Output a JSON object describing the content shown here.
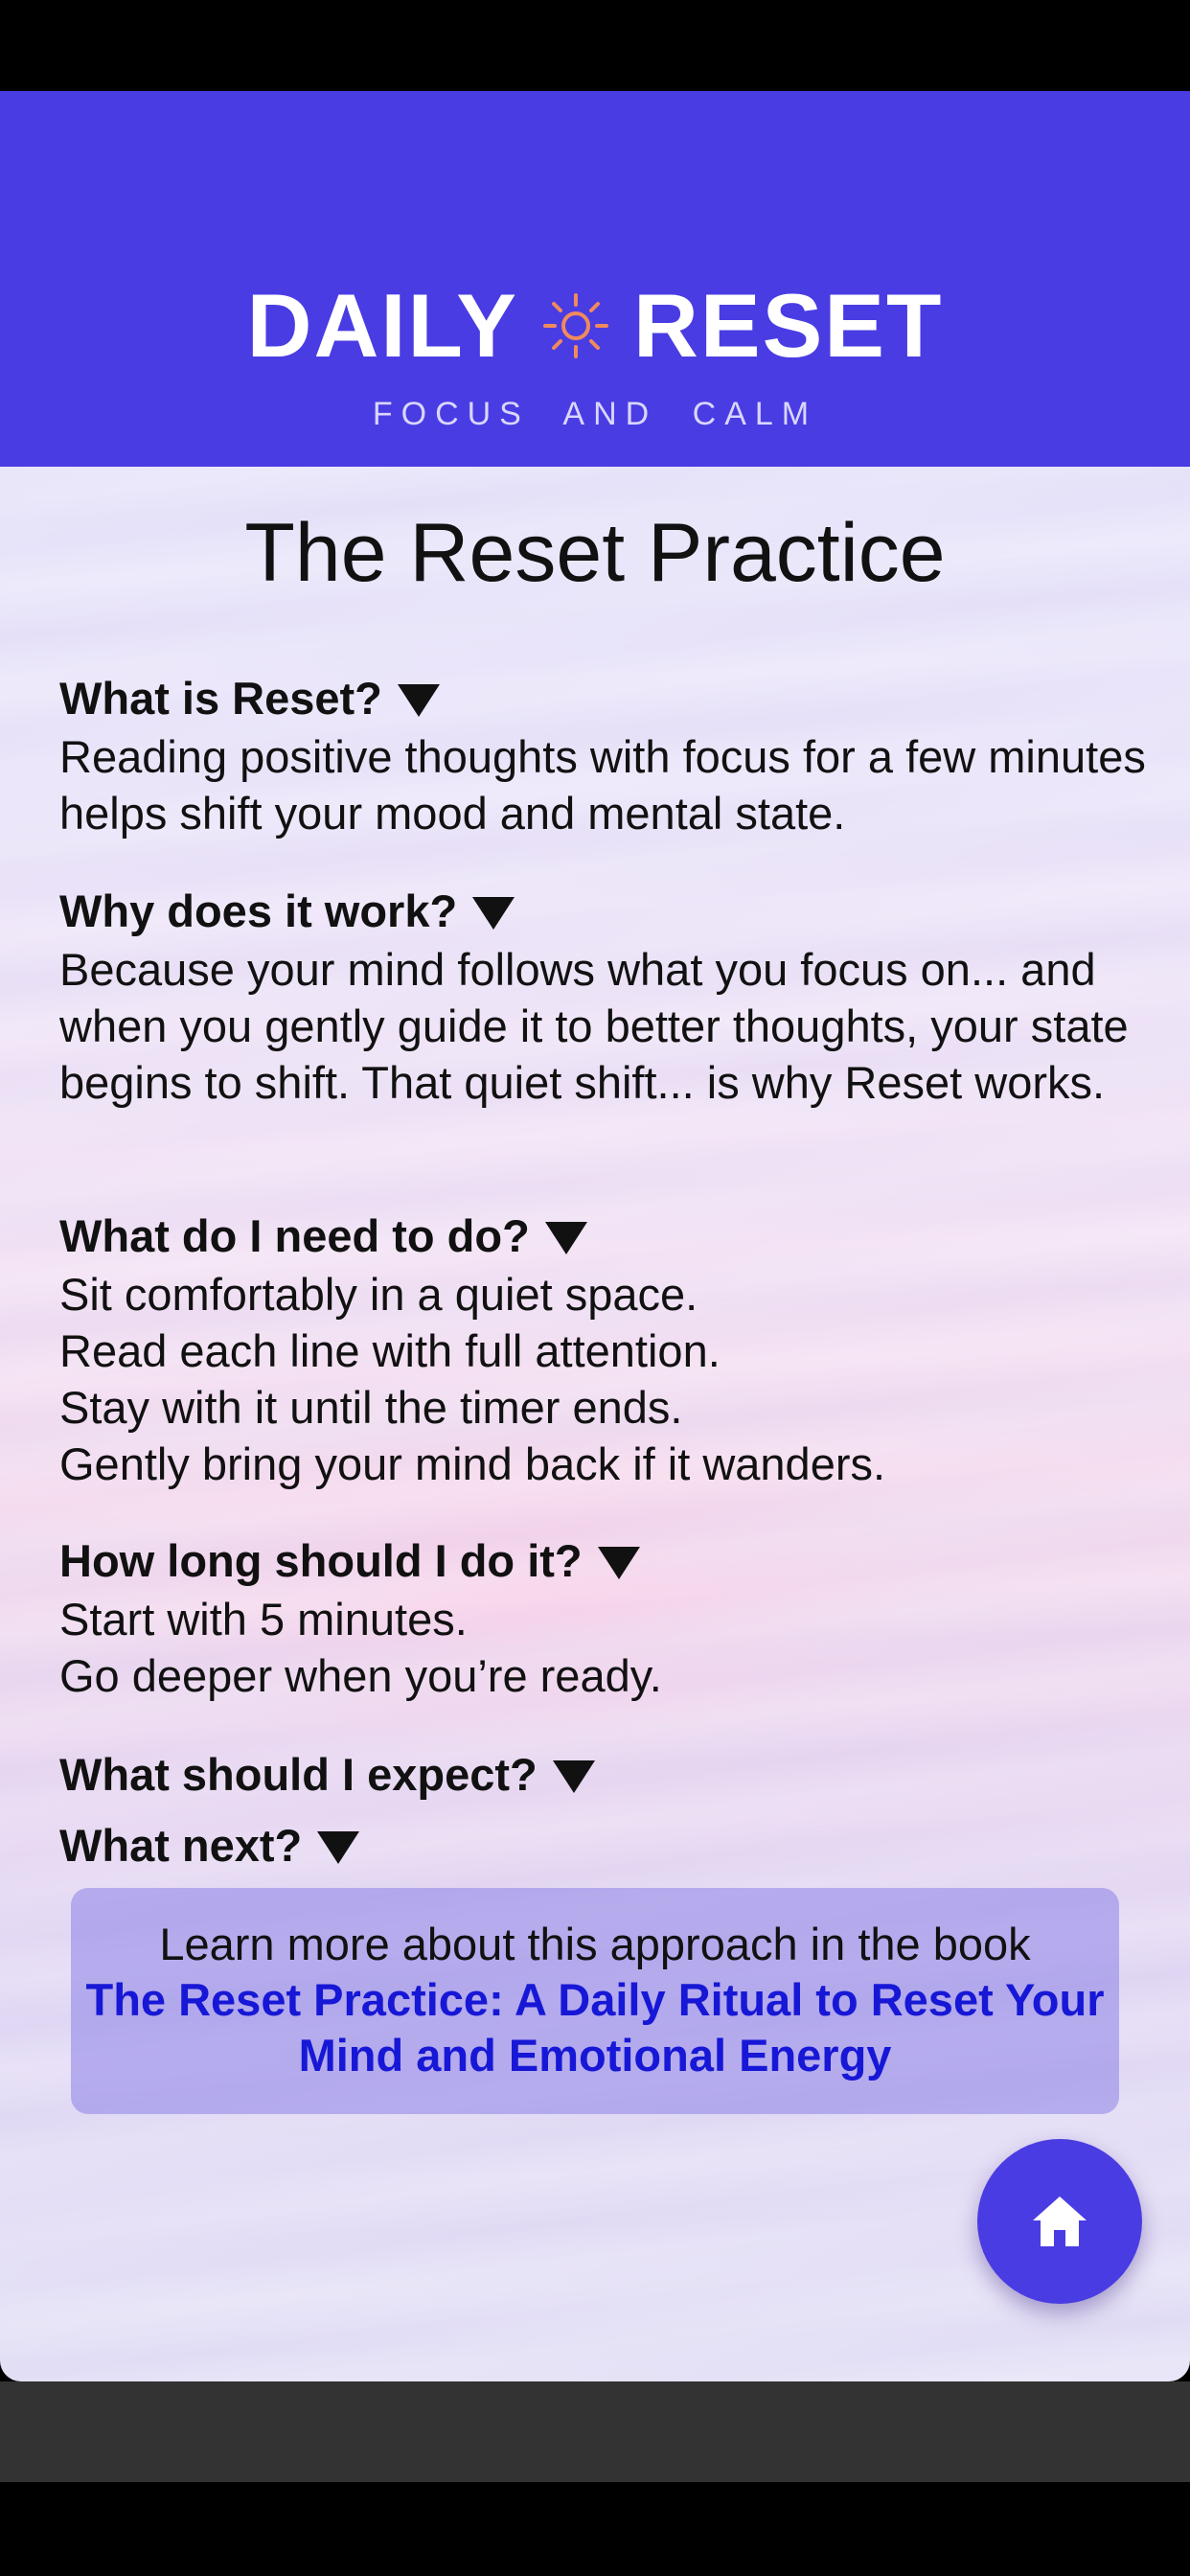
{
  "header": {
    "brand_left": "DAILY",
    "brand_right": "RESET",
    "tagline": "FOCUS AND CALM",
    "sun_icon": "sun-icon",
    "sun_color": "#f08a5d"
  },
  "page": {
    "title": "The Reset Practice"
  },
  "faq": [
    {
      "question": "What is Reset?",
      "answer": [
        "Reading positive thoughts with focus for a few minutes helps shift your mood and mental state."
      ]
    },
    {
      "question": "Why does it work?",
      "answer": [
        "Because your mind follows what you focus on... and when you gently guide it to better thoughts, your state begins to shift. That quiet shift... is why Reset works."
      ]
    },
    {
      "question": "What do I need to do?",
      "answer": [
        "Sit comfortably in a quiet space.",
        "Read each line with full attention.",
        "Stay with it until the timer ends.",
        "Gently bring your mind back if it wanders."
      ]
    },
    {
      "question": "How long should I do it?",
      "answer": [
        "Start with 5 minutes.",
        "Go deeper when you’re ready."
      ]
    },
    {
      "question": "What should I expect?",
      "answer": []
    },
    {
      "question": "What next?",
      "answer": []
    }
  ],
  "book": {
    "lead": "Learn more about this approach in the book",
    "link_text": "The Reset Practice: A Daily Ritual to Reset Your Mind and Emotional Energy"
  },
  "fab": {
    "icon": "home-icon"
  },
  "colors": {
    "accent": "#4a3ce3",
    "link": "#1717d6"
  }
}
